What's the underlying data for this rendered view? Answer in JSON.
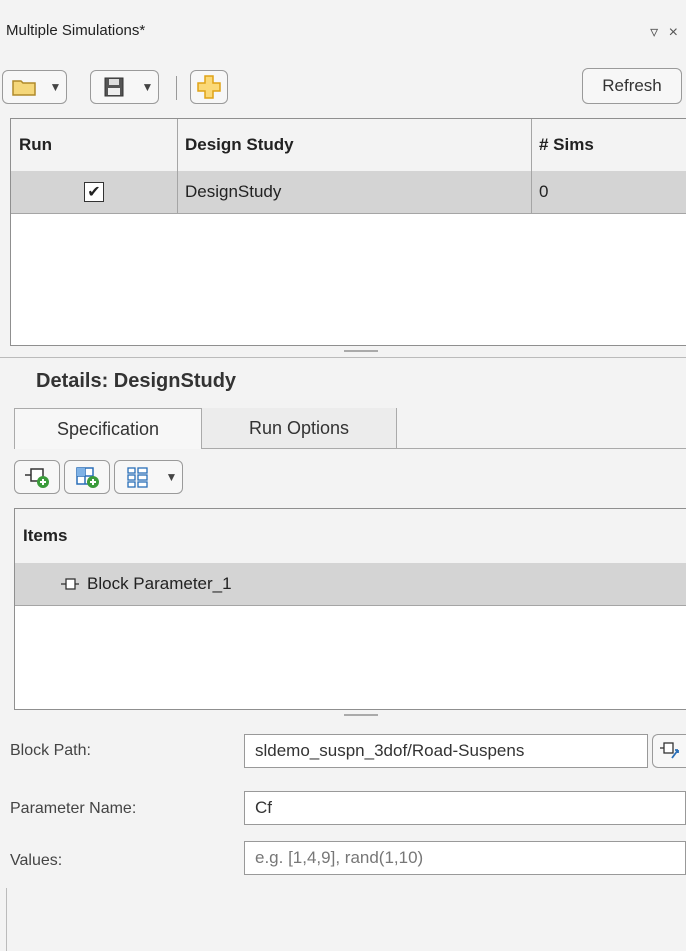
{
  "panel": {
    "title": "Multiple Simulations*"
  },
  "toolbar": {
    "refresh_label": "Refresh"
  },
  "studies_table": {
    "headers": [
      "Run",
      "Design Study",
      "# Sims"
    ],
    "rows": [
      {
        "run": "✔",
        "design_study": "DesignStudy",
        "sims": "0"
      }
    ]
  },
  "details": {
    "title": "Details: DesignStudy",
    "tabs": [
      "Specification",
      "Run Options"
    ],
    "active_tab": "Specification"
  },
  "items_table": {
    "header": "Items",
    "rows": [
      {
        "label": "Block Parameter_1"
      }
    ]
  },
  "form": {
    "block_path_label": "Block Path:",
    "block_path_value": "sldemo_suspn_3dof/Road-Suspens",
    "parameter_name_label": "Parameter Name:",
    "parameter_name_value": "Cf",
    "values_label": "Values:",
    "values_placeholder": "e.g. [1,4,9], rand(1,10)"
  },
  "colors": {
    "selected_row": "#d4d4d4",
    "panel_bg": "#f3f3f3",
    "accent_plus": "#e8a317"
  }
}
